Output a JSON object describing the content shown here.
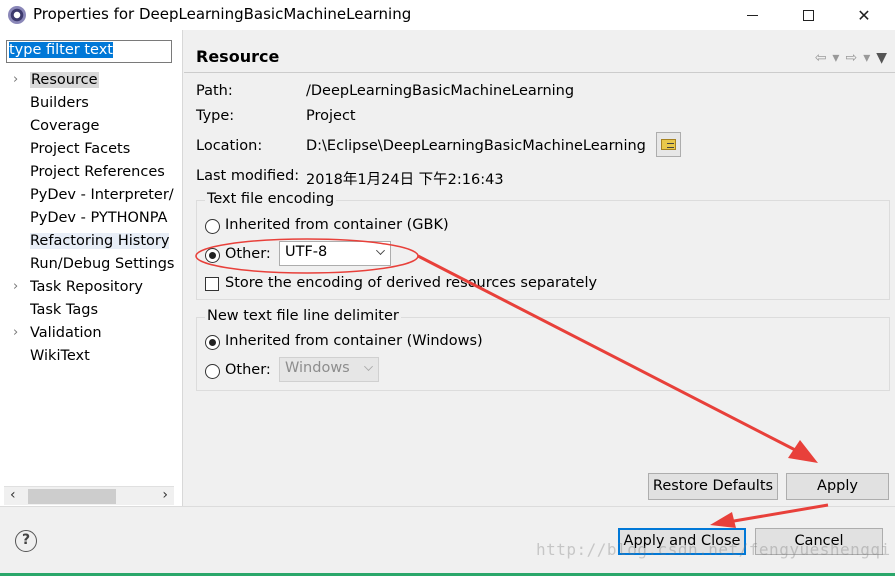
{
  "window": {
    "title": "Properties for DeepLearningBasicMachineLearning",
    "icon": "eclipse-icon"
  },
  "sidebar": {
    "filter_placeholder": "type filter text",
    "items": [
      {
        "label": "Resource",
        "expandable": true,
        "selected": true
      },
      {
        "label": "Builders",
        "expandable": false
      },
      {
        "label": "Coverage",
        "expandable": false
      },
      {
        "label": "Project Facets",
        "expandable": false
      },
      {
        "label": "Project References",
        "expandable": false
      },
      {
        "label": "PyDev - Interpreter/",
        "expandable": false
      },
      {
        "label": "PyDev - PYTHONPA",
        "expandable": false
      },
      {
        "label": "Refactoring History",
        "expandable": false,
        "highlighted": true
      },
      {
        "label": "Run/Debug Settings",
        "expandable": false
      },
      {
        "label": "Task Repository",
        "expandable": true
      },
      {
        "label": "Task Tags",
        "expandable": false
      },
      {
        "label": "Validation",
        "expandable": true
      },
      {
        "label": "WikiText",
        "expandable": false
      }
    ]
  },
  "main": {
    "section_title": "Resource",
    "path_label": "Path:",
    "path_value": "/DeepLearningBasicMachineLearning",
    "type_label": "Type:",
    "type_value": "Project",
    "location_label": "Location:",
    "location_value": "D:\\Eclipse\\DeepLearningBasicMachineLearning",
    "modified_label": "Last modified:",
    "modified_value": "2018年1月24日 下午2:16:43",
    "encoding": {
      "group_title": "Text file encoding",
      "inherited_label": "Inherited from container (GBK)",
      "other_label": "Other:",
      "other_value": "UTF-8",
      "store_label": "Store the encoding of derived resources separately",
      "selected": "other"
    },
    "line_delimiter": {
      "group_title": "New text file line delimiter",
      "inherited_label": "Inherited from container (Windows)",
      "other_label": "Other:",
      "other_value": "Windows",
      "selected": "inherited"
    },
    "restore_defaults_label": "Restore Defaults",
    "apply_label": "Apply"
  },
  "footer": {
    "apply_close_label": "Apply and Close",
    "cancel_label": "Cancel",
    "watermark": "http://blog.csdn.net/fengyueshengqi"
  },
  "colors": {
    "annotation_red": "#e8403a",
    "accent_blue": "#0078d7"
  }
}
